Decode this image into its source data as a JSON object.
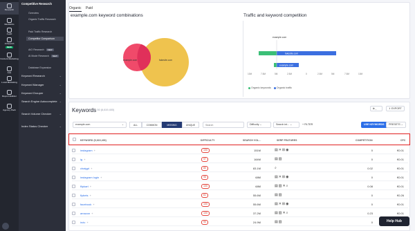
{
  "rail": {
    "items": [
      {
        "label": "Research",
        "active": true
      },
      {
        "label": "Backlinks"
      },
      {
        "label": "Audit"
      },
      {
        "label": "AI Search",
        "badge": "NEW"
      },
      {
        "label": "Content Marketing"
      },
      {
        "label": "Ads"
      },
      {
        "label": "Local Marketing"
      },
      {
        "label": "Report Builder"
      },
      {
        "label": "Agency Pack"
      }
    ]
  },
  "menu": {
    "header": "Competitive Research",
    "items": [
      {
        "label": "Overview"
      },
      {
        "label": "Organic Traffic Research"
      },
      {
        "label": "Paid Traffic Research"
      },
      {
        "label": "Competitor Comparison",
        "selected": true
      },
      {
        "label": "AIO Research",
        "badge": "NEW"
      },
      {
        "label": "AI Mode Research",
        "badge": "NEW"
      },
      {
        "label": "Database Expansion"
      }
    ],
    "sections": [
      {
        "label": "Keyword Research"
      },
      {
        "label": "Keyword Manager"
      },
      {
        "label": "Keyword Grouper"
      },
      {
        "label": "Search Engine Autocomplete"
      },
      {
        "label": "Search Volume Checker"
      },
      {
        "label": "Index Status Checker"
      }
    ]
  },
  "tabs": {
    "organic": "Organic",
    "paid": "Paid"
  },
  "venn": {
    "title": "example.com keyword combinations",
    "left_label": "example.com",
    "right_label": "fakesite.com",
    "colors": {
      "left": "#f04a6a",
      "right": "#f0c04a",
      "overlap": "#e0305a"
    }
  },
  "traffic": {
    "title": "Traffic and keyword competition",
    "bar_label_top": "example.com",
    "bar_label_1": "fakesite.com",
    "bar_label_2": "example.com",
    "axis": [
      "10M",
      "7.5M",
      "5M",
      "2.5M",
      "0",
      "2.5M",
      "5M",
      "7.5M",
      "10M"
    ],
    "legend": {
      "keywords": "Organic keywords",
      "traffic": "Organic traffic"
    },
    "colors": {
      "keywords": "#3bbf77",
      "traffic": "#3b6fe0"
    }
  },
  "keywords": {
    "title": "Keywords",
    "count": "1 - 50 (6,619,400)",
    "export_label": "EXPORT",
    "domain_select": "example.com",
    "segments": [
      "ALL",
      "COMMON",
      "MISSING",
      "UNIQUE"
    ],
    "active_segment": "MISSING",
    "search_placeholder": "Search",
    "difficulty_label": "Difficulty",
    "search_intent_label": "Search int...",
    "filter_label": "FILTER",
    "add_button": "USE KEYWORDS",
    "presets_label": "PRESETS",
    "columns": [
      "KEYWORD (5,619,400)",
      "DIFFICULTY",
      "SEARCH VOL...",
      "SERP FEATURES",
      "COMPETITION",
      "CPC"
    ],
    "rows": [
      {
        "keyword": "instagram",
        "difficulty": "100",
        "volume": "151M",
        "serp": "▤✕⊞◉",
        "competition": "0",
        "cpc": "€0.01"
      },
      {
        "keyword": "ig",
        "difficulty": "97",
        "volume": "164M",
        "serp": "▤▥",
        "competition": "0",
        "cpc": "€0.01"
      },
      {
        "keyword": "chatgpt",
        "difficulty": "80",
        "volume": "83.1M",
        "serp": "⌕",
        "competition": "0.02",
        "cpc": "€0.01"
      },
      {
        "keyword": "instagram login",
        "difficulty": "95",
        "volume": "68M",
        "serp": "▤✕⊞◉",
        "competition": "0",
        "cpc": "€0.01"
      },
      {
        "keyword": "flipkart",
        "difficulty": "100",
        "volume": "68M",
        "serp": "▤▥✕⌕",
        "competition": "0.08",
        "cpc": "€0.01"
      },
      {
        "keyword": "flybets",
        "difficulty": "61",
        "volume": "55.6M",
        "serp": "▤▥",
        "competition": "0",
        "cpc": "€0.26"
      },
      {
        "keyword": "facebook",
        "difficulty": "100",
        "volume": "55.6M",
        "serp": "▤✕⊞◉",
        "competition": "0",
        "cpc": "€0.01"
      },
      {
        "keyword": "amazon",
        "difficulty": "100",
        "volume": "37.2M",
        "serp": "▤▥✕⌕",
        "competition": "0.23",
        "cpc": "€0.01"
      },
      {
        "keyword": "irctc",
        "difficulty": "90",
        "volume": "24.9M",
        "serp": "▤▥",
        "competition": "0",
        "cpc": "€0.01"
      }
    ]
  },
  "help": {
    "label": "Help Hub"
  }
}
